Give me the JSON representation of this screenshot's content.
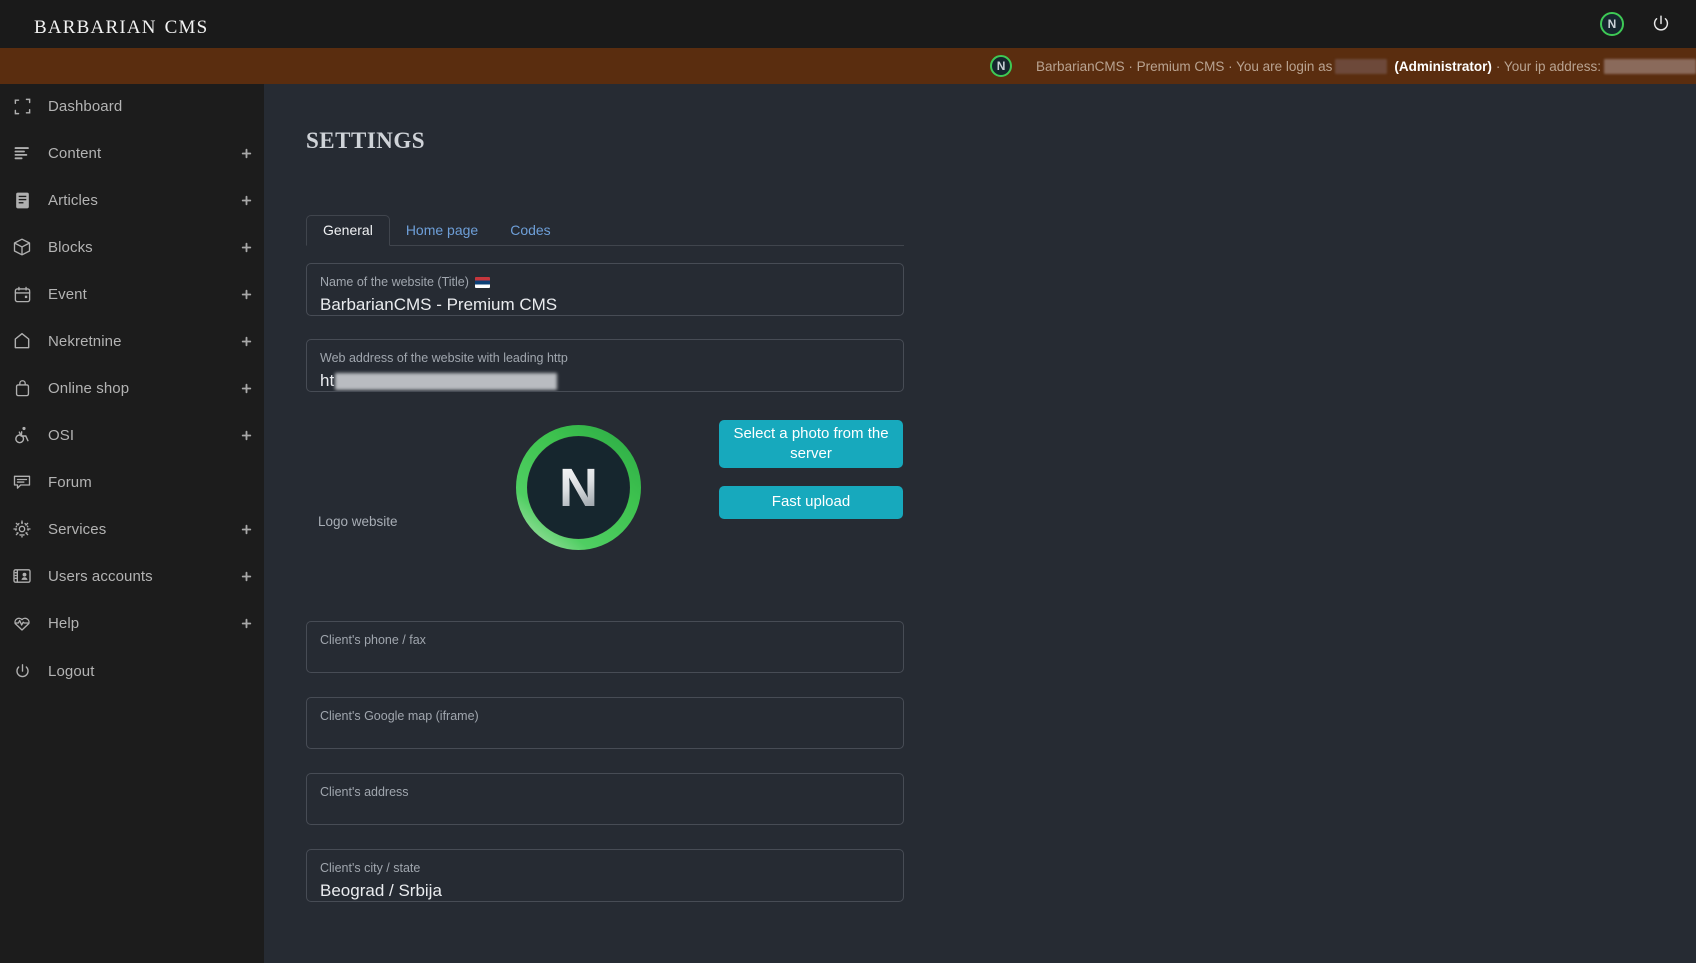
{
  "topbar": {
    "brand": "Barbarian CMS",
    "logo_badge_letter": "N",
    "logo_badge_name": "n-logo-badge",
    "power_icon": "power-icon",
    "accent_green": "#3ec955",
    "background": "#1a1a1a"
  },
  "notice": {
    "background": "#5a2d0f",
    "badge_letter": "N",
    "text_part1": "BarbarianCMS · Premium CMS · You are login as",
    "text_admin": "(Administrator)",
    "text_part2": "· Your ip address:",
    "username_redacted": true,
    "ip_redacted": true
  },
  "sidebar": {
    "background": "#1c1c1c",
    "items": [
      {
        "label": "Dashboard",
        "icon": "dashboard-frame-icon",
        "has_plus": false
      },
      {
        "label": "Content",
        "icon": "content-lines-icon",
        "has_plus": true
      },
      {
        "label": "Articles",
        "icon": "article-document-icon",
        "has_plus": true
      },
      {
        "label": "Blocks",
        "icon": "cube-icon",
        "has_plus": true
      },
      {
        "label": "Event",
        "icon": "calendar-icon",
        "has_plus": true
      },
      {
        "label": "Nekretnine",
        "icon": "house-icon",
        "has_plus": true
      },
      {
        "label": "Online shop",
        "icon": "shopping-bag-icon",
        "has_plus": true
      },
      {
        "label": "OSI",
        "icon": "accessibility-icon",
        "has_plus": true
      },
      {
        "label": "Forum",
        "icon": "chat-bubble-icon",
        "has_plus": false
      },
      {
        "label": "Services",
        "icon": "gear-icon",
        "has_plus": true
      },
      {
        "label": "Users accounts",
        "icon": "id-card-icon",
        "has_plus": true
      },
      {
        "label": "Help",
        "icon": "heart-pulse-icon",
        "has_plus": true
      },
      {
        "label": "Logout",
        "icon": "power-icon",
        "has_plus": false
      }
    ]
  },
  "main": {
    "page_title": "Settings",
    "background": "#262b33",
    "tabs": [
      {
        "label": "General",
        "active": true
      },
      {
        "label": "Home page",
        "active": false
      },
      {
        "label": "Codes",
        "active": false
      }
    ],
    "fields": [
      {
        "label": "Name of the website (Title)",
        "value": "BarbarianCMS - Premium CMS",
        "flag": "rs",
        "redacted": false
      },
      {
        "label": "Web address of the website with leading http",
        "value": "ht",
        "flag": "",
        "redacted": true
      },
      {
        "label": "Client's phone / fax",
        "value": "",
        "flag": "",
        "redacted": false
      },
      {
        "label": "Client's Google map (iframe)",
        "value": "",
        "flag": "",
        "redacted": false
      },
      {
        "label": "Client's address",
        "value": "",
        "flag": "",
        "redacted": false
      },
      {
        "label": "Client's city / state",
        "value": "Beograd / Srbija",
        "flag": "",
        "redacted": false
      }
    ],
    "logo_section": {
      "label": "Logo website",
      "logo_letter": "N",
      "logo_ring_color": "#3fc85a",
      "logo_center_color": "#16262e",
      "select_button": "Select a photo from the server",
      "fast_upload_button": "Fast upload",
      "button_color": "#17a9bd"
    }
  }
}
